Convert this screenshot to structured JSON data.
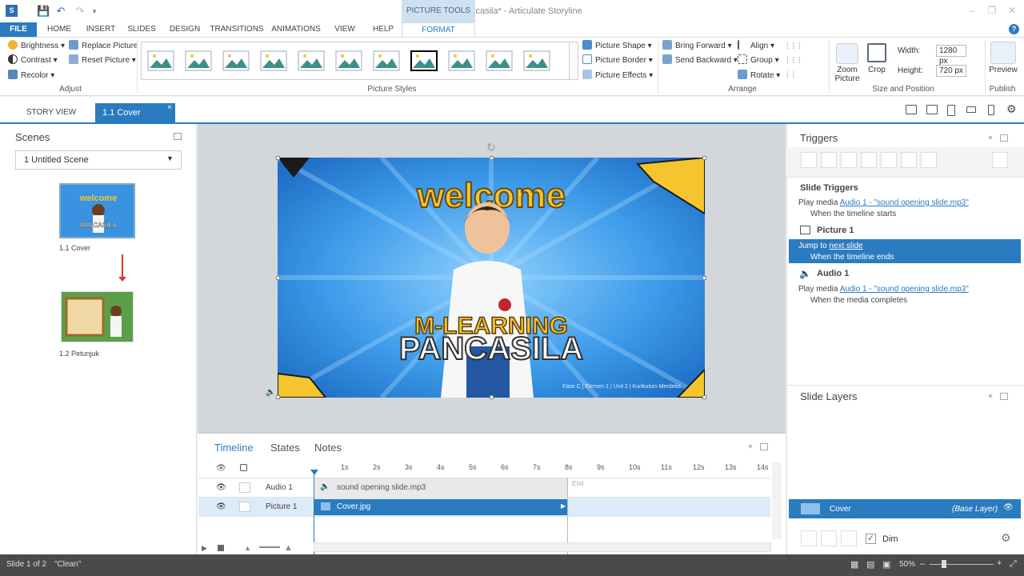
{
  "window": {
    "title": "MPI Pancasila* - Articulate Storyline",
    "context_tab": "PICTURE TOOLS",
    "app_logo": "S"
  },
  "tabs": [
    "FILE",
    "HOME",
    "INSERT",
    "SLIDES",
    "DESIGN",
    "TRANSITIONS",
    "ANIMATIONS",
    "VIEW",
    "HELP",
    "FORMAT"
  ],
  "ribbon": {
    "adjust": {
      "brightness": "Brightness",
      "contrast": "Contrast",
      "recolor": "Recolor",
      "replace": "Replace Picture",
      "reset": "Reset Picture",
      "label": "Adjust"
    },
    "styles_label": "Picture Styles",
    "shape": {
      "shape": "Picture Shape",
      "border": "Picture Border",
      "effects": "Picture Effects"
    },
    "arrange": {
      "forward": "Bring Forward",
      "backward": "Send Backward",
      "align": "Align",
      "group": "Group",
      "rotate": "Rotate",
      "label": "Arrange"
    },
    "zoom": {
      "l1": "Zoom",
      "l2": "Picture"
    },
    "crop": "Crop",
    "size": {
      "width_label": "Width:",
      "width_value": "1280 px",
      "height_label": "Height:",
      "height_value": "720 px",
      "label": "Size and Position"
    },
    "preview": {
      "label": "Preview",
      "group": "Publish"
    }
  },
  "doc_tabs": {
    "story": "STORY VIEW",
    "cover": "1.1 Cover"
  },
  "scenes": {
    "title": "Scenes",
    "selected": "1 Untitled Scene",
    "slides": [
      {
        "label": "1.1 Cover"
      },
      {
        "label": "1.2 Petunjuk"
      }
    ]
  },
  "slide": {
    "welcome": "welcome",
    "line1": "M-LEARNING",
    "line2": "PANCASILA",
    "footer": "Fase C | Elemen 1 | Unit 2 | Kurikulum Merdeka"
  },
  "timeline": {
    "tabs": [
      "Timeline",
      "States",
      "Notes"
    ],
    "ticks": [
      "1s",
      "2s",
      "3s",
      "4s",
      "5s",
      "6s",
      "7s",
      "8s",
      "9s",
      "10s",
      "11s",
      "12s",
      "13s",
      "14s"
    ],
    "rows": [
      {
        "name": "Audio 1",
        "bar": "sound opening slide.mp3"
      },
      {
        "name": "Picture 1",
        "bar": "Cover.jpg"
      }
    ],
    "end_label": "End"
  },
  "triggers": {
    "title": "Triggers",
    "section": "Slide Triggers",
    "t1_action": "Play media",
    "t1_link": "Audio 1 - \"sound opening slide.mp3\"",
    "t1_when": "When the timeline starts",
    "obj1": "Picture 1",
    "t2_action": "Jump to",
    "t2_link": "next slide",
    "t2_when": "When the timeline ends",
    "obj2": "Audio 1",
    "t3_action": "Play media",
    "t3_link": "Audio 1 - \"sound opening slide.mp3\"",
    "t3_when": "When the media completes"
  },
  "layers": {
    "title": "Slide Layers",
    "base_name": "Cover",
    "base_tag": "(Base Layer)",
    "dim": "Dim"
  },
  "status": {
    "slide": "Slide 1 of 2",
    "theme": "\"Clean\"",
    "zoom": "50%"
  },
  "colors": {
    "accent": "#2b7bc0"
  }
}
